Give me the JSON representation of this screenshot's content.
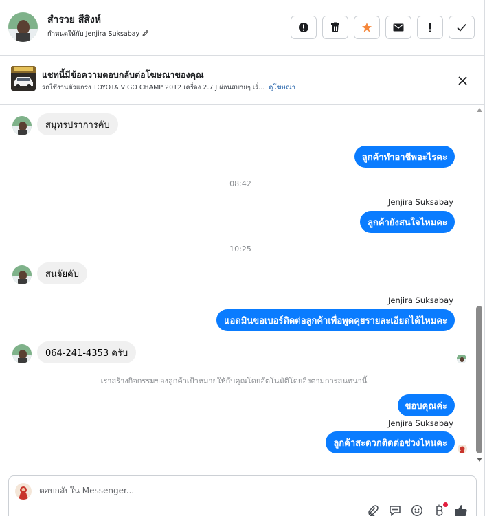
{
  "header": {
    "contact_name": "สำรวย สีสิงห์",
    "assigned_label": "กำหนดให้กับ Jenjira Suksabay",
    "tools": [
      {
        "name": "report-spam-icon",
        "symbol": "alert-circle"
      },
      {
        "name": "trash-icon",
        "symbol": "trash"
      },
      {
        "name": "star-icon",
        "symbol": "star",
        "color": "#f5873b"
      },
      {
        "name": "mail-icon",
        "symbol": "envelope"
      },
      {
        "name": "exclamation-icon",
        "symbol": "!"
      },
      {
        "name": "check-icon",
        "symbol": "check"
      }
    ]
  },
  "ad_banner": {
    "title": "แชทนี้มีข้อความตอบกลับต่อโฆษณาของคุณ",
    "description": "รถใช้งานตัวแกร่ง TOYOTA VIGO CHAMP 2012 เครื่อง 2.7 J ผ่อนสบายๆ เริ่...",
    "link": "ดูโฆษณา",
    "close_icon": "close-icon"
  },
  "messages": {
    "in_1": "สมุทรปราการคับ",
    "out_1": "ลูกค้าทำอาชีพอะไรคะ",
    "time_1": "08:42",
    "sender_1": "Jenjira Suksabay",
    "out_2": "ลูกค้ายังสนใจไหมคะ",
    "time_2": "10:25",
    "in_2": "สนจัยคับ",
    "sender_2": "Jenjira Suksabay",
    "out_3": "แอดมินขอเบอร์ติดต่อลูกค้าเพื่อพูดคุยรายละเอียดได้ไหมคะ",
    "in_3": "064-241-4353 ครับ",
    "system_note": "เราสร้างกิจกรรมของลูกค้าเป้าหมายให้กับคุณโดยอัตโนมัติโดยอิงตามการสนทนานี้",
    "out_4": "ขอบคุณค่ะ",
    "sender_3": "Jenjira Suksabay",
    "out_5": "ลูกค้าสะดวกติดต่อช่วงไหนคะ"
  },
  "composer": {
    "placeholder": "ตอบกลับใน Messenger...",
    "tools": [
      "attachment-icon",
      "saved-replies-icon",
      "emoji-icon",
      "payment-icon",
      "like-icon"
    ]
  },
  "colors": {
    "outgoing_bubble": "#0a7cff",
    "incoming_bubble": "#f0f0f0",
    "accent_star": "#f5873b",
    "link": "#1f5fa8"
  }
}
